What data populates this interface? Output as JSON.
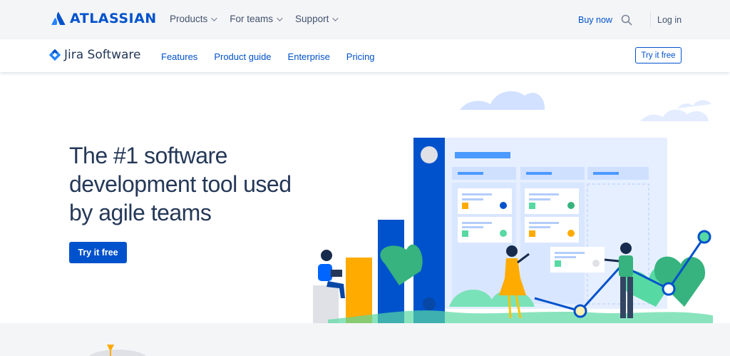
{
  "global_nav": {
    "brand": "ATLASSIAN",
    "menu": [
      {
        "label": "Products"
      },
      {
        "label": "For teams"
      },
      {
        "label": "Support"
      }
    ],
    "buy_now": "Buy now",
    "login": "Log in"
  },
  "product_nav": {
    "brand": "Jira Software",
    "menu": [
      {
        "label": "Features"
      },
      {
        "label": "Product guide"
      },
      {
        "label": "Enterprise"
      },
      {
        "label": "Pricing"
      }
    ],
    "try_label": "Try it free"
  },
  "hero": {
    "title": "The #1 software development tool used by agile teams",
    "cta_label": "Try it free"
  },
  "colors": {
    "brand_blue": "#0052cc",
    "text_dark": "#253858",
    "nav_bg": "#f4f5f7"
  },
  "icons": {
    "atlassian_logo": "atlassian-logo-icon",
    "jira_logo": "jira-diamond-icon",
    "search": "search-icon",
    "dropdown": "chevron-down-icon"
  }
}
